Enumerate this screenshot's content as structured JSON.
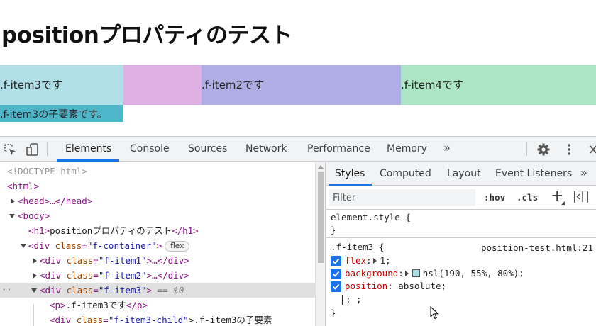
{
  "page": {
    "title": "positionプロパティのテスト",
    "items": {
      "item3": ".f-item3です",
      "item1": "",
      "item2": ".f-item2です",
      "item4": ".f-item4です"
    },
    "child": ".f-item3の子要素です。",
    "colors": {
      "item3": "#abdde6",
      "item1": "#dfaee2",
      "item2": "#aeaee4",
      "item4": "#ade6c4",
      "child": "#4fb6c9"
    }
  },
  "devtools": {
    "toolbar_icons": [
      "inspect-element-icon",
      "device-toolbar-icon"
    ],
    "tabs": [
      "Elements",
      "Console",
      "Sources",
      "Network",
      "Performance",
      "Memory"
    ],
    "more_tabs": "»",
    "active_tab": "Elements",
    "right_icons": [
      "gear-icon",
      "more-vertical-icon",
      "close-icon"
    ],
    "accent": "#1a73e8",
    "dom": {
      "doctype": "<!DOCTYPE html>",
      "html_open": "<html>",
      "head": "<head>…</head>",
      "body_open": "<body>",
      "h1_open": "<h1>",
      "h1_text": "positionプロパティのテスト",
      "h1_close": "</h1>",
      "container_tag": "<div",
      "container_attr": "class",
      "container_value": "\"f-container\"",
      "container_close": ">",
      "container_badge": "flex",
      "item1": {
        "tag": "<div",
        "attr": "class",
        "value": "\"f-item1\"",
        "rest": ">…</div>"
      },
      "item2": {
        "tag": "<div",
        "attr": "class",
        "value": "\"f-item2\"",
        "rest": ">…</div>"
      },
      "item3": {
        "tag": "<div",
        "attr": "class",
        "value": "\"f-item3\"",
        "close": ">",
        "eq": "== $0"
      },
      "p_open": "<p>",
      "p_text": ".f-item3です",
      "p_close": "</p>",
      "child_tag": "<div",
      "child_attr": "class",
      "child_value": "\"f-item3-child\"",
      "child_rest": ">.f-item3の子要素",
      "dots": "··"
    },
    "styles": {
      "tabs": [
        "Styles",
        "Computed",
        "Layout",
        "Event Listeners"
      ],
      "more_tabs": "»",
      "active_tab": "Styles",
      "filter_placeholder": "Filter",
      "hov": ":hov",
      "cls": ".cls",
      "plus": "+",
      "element_style_selector": "element.style {",
      "brace_close": "}",
      "rule_selector": ".f-item3 {",
      "rule_source": "position-test.html:21",
      "declarations": [
        {
          "name": "flex",
          "value": "1;",
          "checked": true
        },
        {
          "name": "background",
          "value": "hsl(190, 55%, 80%);",
          "checked": true,
          "swatch": "#abdde6"
        },
        {
          "name": "position",
          "value": "absolute;",
          "checked": true
        }
      ],
      "editing_line": ": ;"
    }
  }
}
